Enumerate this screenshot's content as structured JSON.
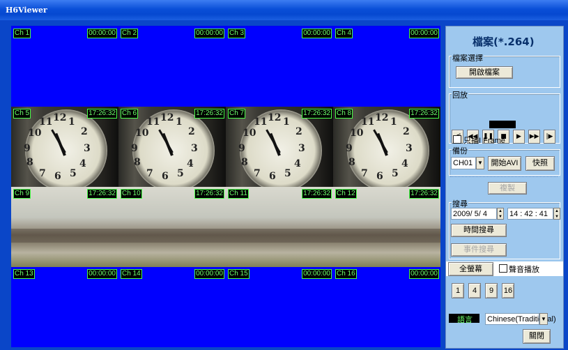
{
  "window": {
    "title": "H6Viewer"
  },
  "cells": [
    {
      "ch": "Ch 1",
      "time": "00:00:00",
      "kind": "blue"
    },
    {
      "ch": "Ch 2",
      "time": "00:00:00",
      "kind": "blue"
    },
    {
      "ch": "Ch 3",
      "time": "00:00:00",
      "kind": "blue"
    },
    {
      "ch": "Ch 4",
      "time": "00:00:00",
      "kind": "blue"
    },
    {
      "ch": "Ch 5",
      "time": "17:26:32",
      "kind": "clock"
    },
    {
      "ch": "Ch 6",
      "time": "17:26:32",
      "kind": "clock"
    },
    {
      "ch": "Ch 7",
      "time": "17:26:32",
      "kind": "clock"
    },
    {
      "ch": "Ch 8",
      "time": "17:26:32",
      "kind": "clock"
    },
    {
      "ch": "Ch 9",
      "time": "17:26:32",
      "kind": "scene"
    },
    {
      "ch": "Ch 10",
      "time": "17:26:32",
      "kind": "scene"
    },
    {
      "ch": "Ch 11",
      "time": "17:26:32",
      "kind": "scene"
    },
    {
      "ch": "Ch 12",
      "time": "17:26:32",
      "kind": "scene"
    },
    {
      "ch": "Ch 13",
      "time": "00:00:00",
      "kind": "blue"
    },
    {
      "ch": "Ch 14",
      "time": "00:00:00",
      "kind": "blue"
    },
    {
      "ch": "Ch 15",
      "time": "00:00:00",
      "kind": "blue"
    },
    {
      "ch": "Ch 16",
      "time": "00:00:00",
      "kind": "blue"
    }
  ],
  "clock_numbers": [
    "10",
    "11",
    "12",
    "1",
    "2",
    "9",
    "3",
    "8",
    "7",
    "6",
    "5",
    "4"
  ],
  "panel": {
    "header": "檔案(*.264)",
    "file_group": {
      "label": "檔案選擇",
      "open_button": "開啟檔案"
    },
    "playback": {
      "label": "回放",
      "buttons": [
        {
          "icon": "step-back-icon",
          "glyph": "◀|"
        },
        {
          "icon": "rewind-icon",
          "glyph": "◀◀"
        },
        {
          "icon": "pause-icon",
          "glyph": "❚❚"
        },
        {
          "icon": "stop-icon",
          "glyph": "■"
        },
        {
          "icon": "play-icon",
          "glyph": "▶"
        },
        {
          "icon": "fast-forward-icon",
          "glyph": "▶▶"
        },
        {
          "icon": "step-forward-icon",
          "glyph": "|▶"
        }
      ],
      "iframe_label": "只播I Frame"
    },
    "backup": {
      "label": "備份",
      "channel": "CH01",
      "avi_button": "開始AVI",
      "snapshot_button": "快照"
    },
    "copy_button": "複製",
    "search": {
      "label": "搜尋",
      "date": "2009/ 5/ 4",
      "time": "14 : 42 : 41",
      "time_search": "時間搜尋",
      "event_search": "事件搜尋"
    },
    "fullscreen_button": "全螢幕",
    "audio_label": "聲音播放",
    "layout_buttons": [
      "1",
      "4",
      "9",
      "16"
    ],
    "language_label": "語言",
    "language_value": "Chinese(Traditional)",
    "close_button": "關閉"
  },
  "colors": {
    "grid_blue": "#0000ff",
    "panel": "#9ec8ee",
    "overlay_text": "#6cff6c",
    "title_bar": "#0a4fd8"
  }
}
